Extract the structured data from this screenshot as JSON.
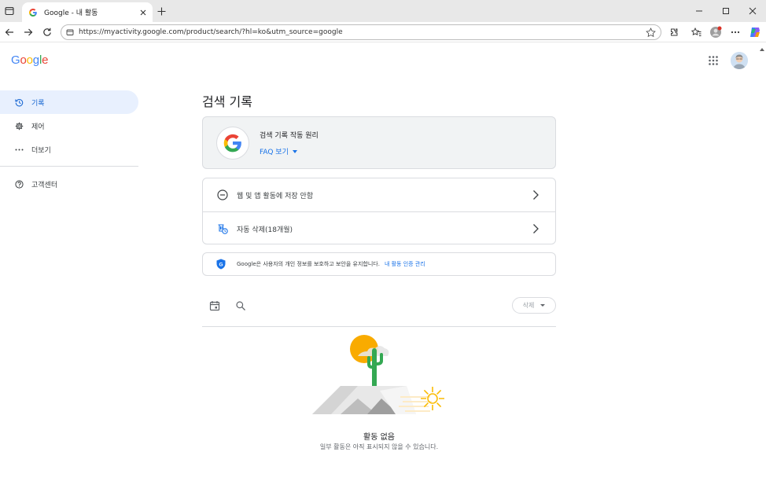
{
  "browser": {
    "tab_title": "Google - 내 활동",
    "url": "https://myactivity.google.com/product/search/?hl=ko&utm_source=google"
  },
  "page": {
    "logo": {
      "g1": "G",
      "o1": "o",
      "o2": "o",
      "g2": "g",
      "l": "l",
      "e": "e"
    },
    "sidebar": {
      "items": [
        {
          "label": "기록",
          "icon": "history-icon",
          "active": true
        },
        {
          "label": "제어",
          "icon": "gear-icon",
          "active": false
        },
        {
          "label": "더보기",
          "icon": "more-icon",
          "active": false
        }
      ],
      "help": {
        "label": "고객센터",
        "icon": "help-icon"
      }
    },
    "title": "검색 기록",
    "info_card": {
      "title": "검색 기록 작동 원리",
      "faq": "FAQ 보기"
    },
    "settings": [
      {
        "label": "웹 및 앱 활동에 저장 안함",
        "icon": "minus-circle-icon"
      },
      {
        "label": "자동 삭제(18개월)",
        "icon": "auto-delete-icon"
      }
    ],
    "privacy": {
      "text": "Google은 사용자의 개인 정보를 보호하고 보안을 유지합니다.",
      "link": "내 활동 인증 관리"
    },
    "filter": {
      "delete_label": "삭제"
    },
    "empty": {
      "title": "활동 없음",
      "subtitle": "일부 활동은 아직 표시되지 않을 수 있습니다."
    }
  },
  "colors": {
    "accent": "#1a73e8",
    "active_bg": "#e8f0fe",
    "border": "#dadce0"
  }
}
